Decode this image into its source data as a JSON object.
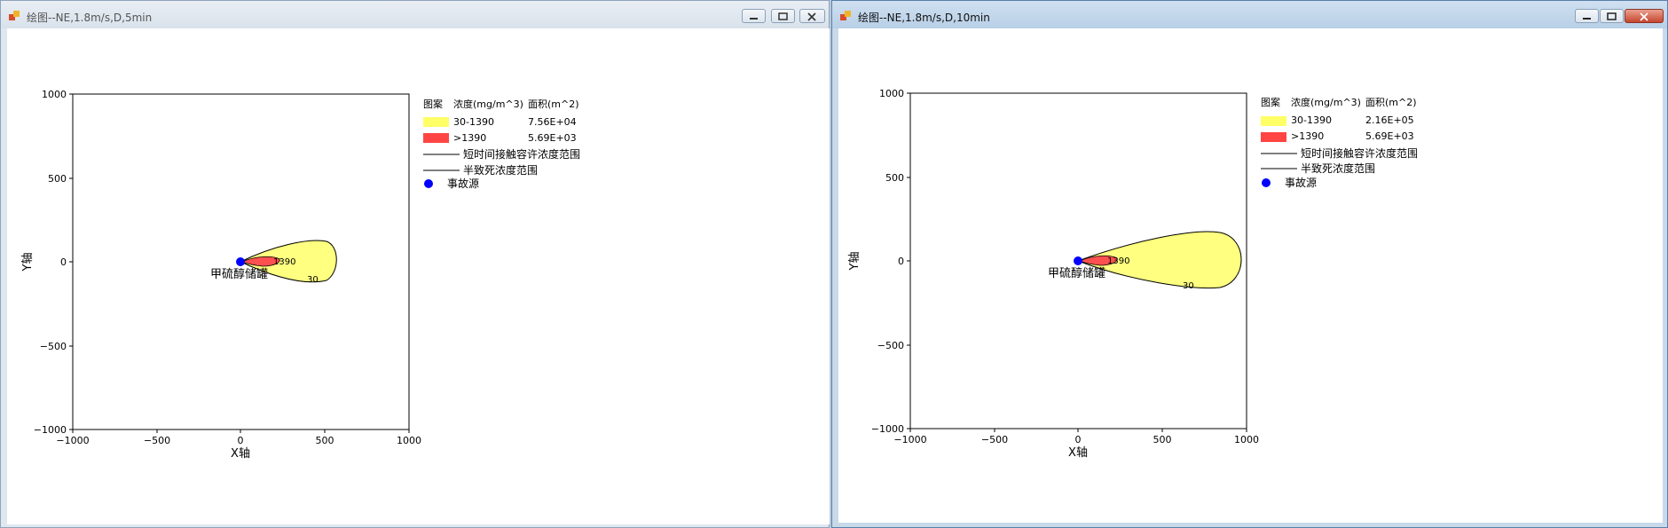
{
  "windows": [
    {
      "title": "绘图--NE,1.8m/s,D,5min",
      "plot": {
        "xlabel": "X轴",
        "ylabel": "Y轴",
        "xticks": [
          "−1000",
          "−500",
          "0",
          "500",
          "1000"
        ],
        "yticks": [
          "1000",
          "500",
          "0",
          "−500",
          "−1000"
        ],
        "source_label": "甲硫醇储罐",
        "contour_labels": {
          "outer": "30",
          "inner": "1390"
        }
      },
      "legend": {
        "header": {
          "pattern": "图案",
          "concentration": "浓度(mg/m^3)",
          "area": "面积(m^2)"
        },
        "rows": [
          {
            "range": "30-1390",
            "area": "7.56E+04",
            "color": "#ffff66"
          },
          {
            "range": ">1390",
            "area": "5.69E+03",
            "color": "#ff4444"
          }
        ],
        "lines": [
          "短时间接触容许浓度范围",
          "半致死浓度范围"
        ],
        "source": "事故源"
      }
    },
    {
      "title": "绘图--NE,1.8m/s,D,10min",
      "plot": {
        "xlabel": "X轴",
        "ylabel": "Y轴",
        "xticks": [
          "−1000",
          "−500",
          "0",
          "500",
          "1000"
        ],
        "yticks": [
          "1000",
          "500",
          "0",
          "−500",
          "−1000"
        ],
        "source_label": "甲硫醇储罐",
        "contour_labels": {
          "outer": "30",
          "inner": "1390"
        }
      },
      "legend": {
        "header": {
          "pattern": "图案",
          "concentration": "浓度(mg/m^3)",
          "area": "面积(m^2)"
        },
        "rows": [
          {
            "range": "30-1390",
            "area": "2.16E+05",
            "color": "#ffff66"
          },
          {
            "range": ">1390",
            "area": "5.69E+03",
            "color": "#ff4444"
          }
        ],
        "lines": [
          "短时间接触容许浓度范围",
          "半致死浓度范围"
        ],
        "source": "事故源"
      }
    }
  ],
  "colors": {
    "yellow_zone": "#ffff80",
    "red_zone": "#ff5050",
    "source_marker": "#0000ff"
  }
}
